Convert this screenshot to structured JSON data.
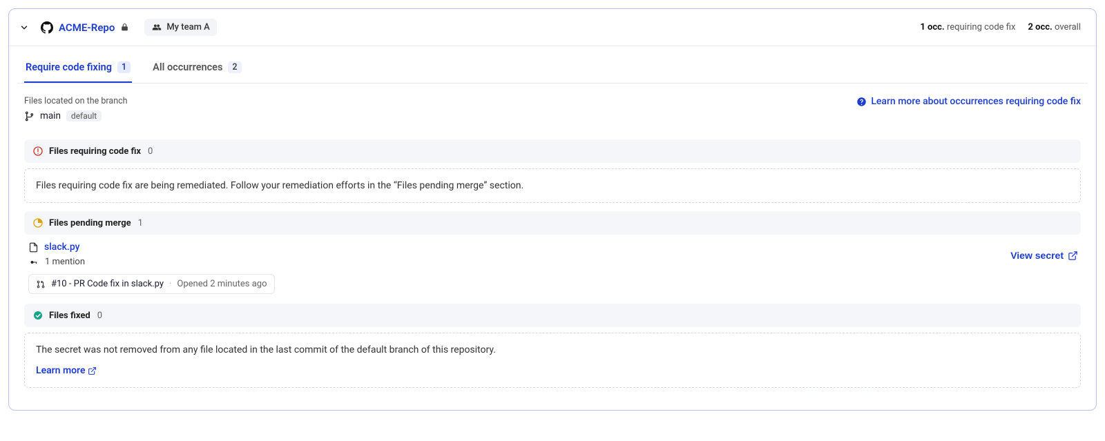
{
  "header": {
    "repo_name": "ACME-Repo",
    "team_label": "My team A",
    "occ_fix_count": "1 occ.",
    "occ_fix_label": "requiring code fix",
    "occ_overall_count": "2 occ.",
    "occ_overall_label": "overall"
  },
  "tabs": {
    "require": {
      "label": "Require code fixing",
      "badge": "1"
    },
    "all": {
      "label": "All occurrences",
      "badge": "2"
    }
  },
  "branch": {
    "caption": "Files located on the branch",
    "name": "main",
    "default_tag": "default"
  },
  "links": {
    "learn_more_occ": "Learn more about occurrences requiring code fix",
    "view_secret": "View secret",
    "learn_more": "Learn more"
  },
  "sections": {
    "requiring_fix": {
      "title": "Files requiring code fix",
      "count": "0",
      "note": "Files requiring code fix are being remediated. Follow your remediation efforts in the “Files pending merge” section."
    },
    "pending_merge": {
      "title": "Files pending merge",
      "count": "1"
    },
    "files_fixed": {
      "title": "Files fixed",
      "count": "0",
      "note": "The secret was not removed from any file located in the last commit of the default branch of this repository."
    }
  },
  "file": {
    "name": "slack.py",
    "mention": "1 mention",
    "pr_label": "#10 - PR Code fix in slack.py",
    "pr_time": "Opened 2 minutes ago"
  }
}
